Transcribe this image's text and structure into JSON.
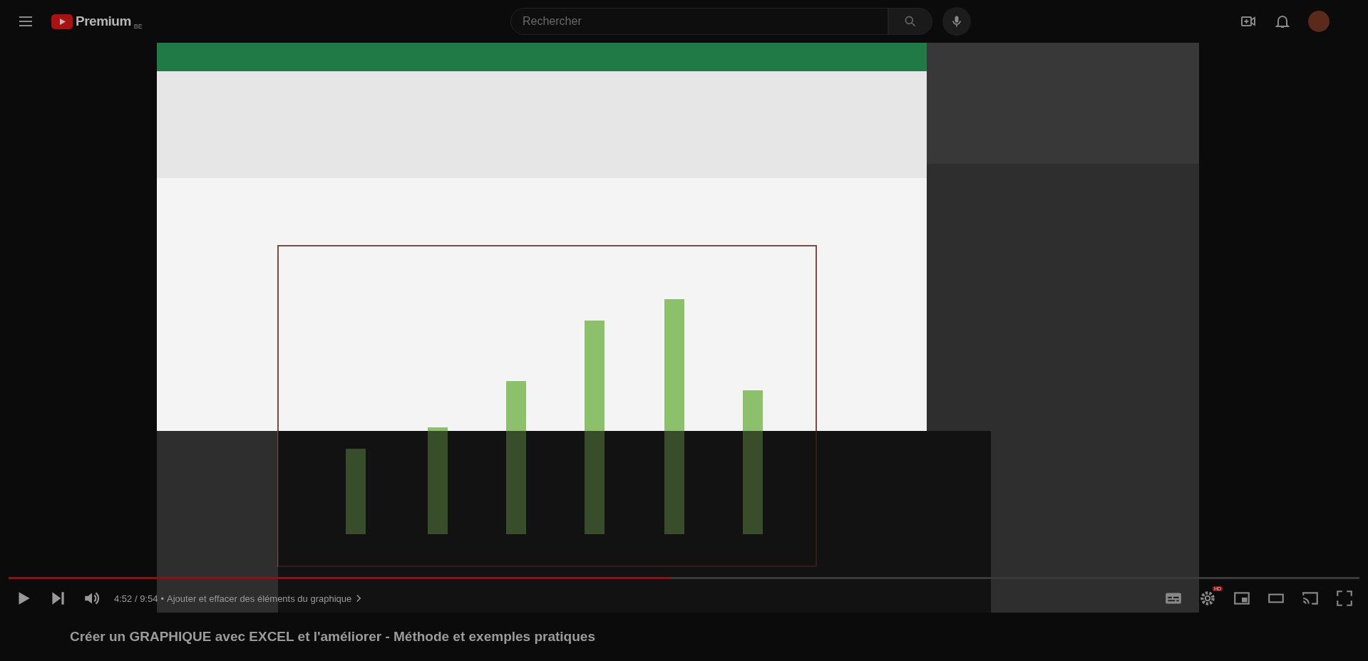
{
  "header": {
    "logo": "Premium",
    "country": "BE",
    "search": {
      "placeholder": "Rechercher"
    }
  },
  "player": {
    "progress": {
      "level": 0.49
    },
    "time": "4:52 / 9:54",
    "chapter_separator": "•",
    "chapter": "Ajouter et effacer des éléments du graphique",
    "hd_badge": "HD"
  },
  "title": "Créer un GRAPHIQUE avec EXCEL et l'améliorer - Méthode et exemples pratiques"
}
